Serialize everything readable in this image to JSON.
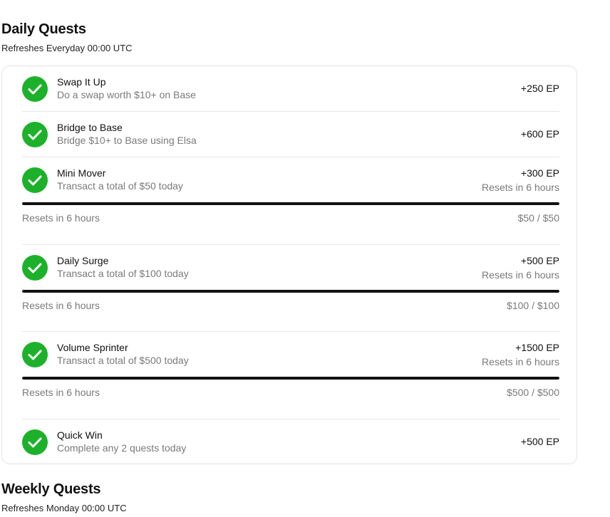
{
  "daily": {
    "title": "Daily Quests",
    "subtitle": "Refreshes Everyday 00:00 UTC"
  },
  "weekly": {
    "title": "Weekly Quests",
    "subtitle": "Refreshes Monday 00:00 UTC"
  },
  "quests": [
    {
      "title": "Swap It Up",
      "desc": "Do a swap worth $10+ on Base",
      "points": "+250 EP",
      "completed": true,
      "icon": "check-circle-icon"
    },
    {
      "title": "Bridge to Base",
      "desc": "Bridge $10+ to Base using Elsa",
      "points": "+600 EP",
      "completed": true,
      "icon": "check-circle-icon"
    },
    {
      "title": "Mini Mover",
      "desc": "Transact a total of $50 today",
      "points": "+300 EP",
      "reset": "Resets in 6 hours",
      "progress_reset": "Resets in 6 hours",
      "progress_text": "$50 / $50",
      "progress": 1.0,
      "completed": true,
      "icon": "check-circle-icon"
    },
    {
      "title": "Daily Surge",
      "desc": "Transact a total of $100 today",
      "points": "+500 EP",
      "reset": "Resets in 6 hours",
      "progress_reset": "Resets in 6 hours",
      "progress_text": "$100 / $100",
      "progress": 1.0,
      "completed": true,
      "icon": "check-circle-icon"
    },
    {
      "title": "Volume Sprinter",
      "desc": "Transact a total of $500 today",
      "points": "+1500 EP",
      "reset": "Resets in 6 hours",
      "progress_reset": "Resets in 6 hours",
      "progress_text": "$500 / $500",
      "progress": 1.0,
      "completed": true,
      "icon": "check-circle-icon"
    },
    {
      "title": "Quick Win",
      "desc": "Complete any 2 quests today",
      "points": "+500 EP",
      "completed": true,
      "icon": "check-circle-icon"
    }
  ],
  "colors": {
    "check": "#1db12b",
    "progress_fill": "#111111",
    "muted_text": "#7a7a7a",
    "border": "#e3e3e3"
  }
}
